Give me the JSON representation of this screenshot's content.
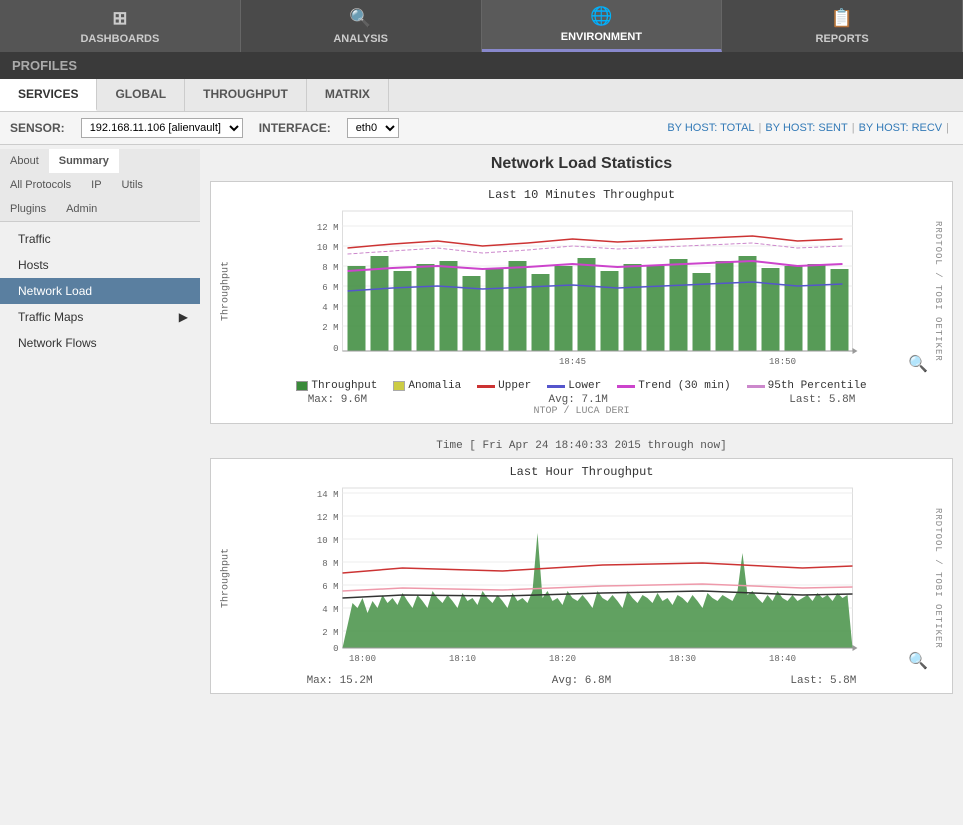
{
  "nav": {
    "items": [
      {
        "id": "dashboards",
        "label": "DASHBOARDS",
        "icon": "⊞",
        "active": false
      },
      {
        "id": "analysis",
        "label": "ANALYSIS",
        "icon": "🔍",
        "active": false
      },
      {
        "id": "environment",
        "label": "ENVIRONMENT",
        "icon": "🌐",
        "active": true
      },
      {
        "id": "reports",
        "label": "REPORTS",
        "icon": "📋",
        "active": false
      }
    ]
  },
  "profiles_label": "PROFILES",
  "sub_tabs": [
    {
      "label": "SERVICES",
      "active": true
    },
    {
      "label": "GLOBAL",
      "active": false
    },
    {
      "label": "THROUGHPUT",
      "active": false
    },
    {
      "label": "MATRIX",
      "active": false
    }
  ],
  "sensor": {
    "label": "SENSOR:",
    "value": "192.168.11.106 [alienvault]",
    "interface_label": "INTERFACE:",
    "interface_value": "eth0"
  },
  "by_host": {
    "total": "BY HOST: TOTAL",
    "sent": "BY HOST: SENT",
    "recv": "BY HOST: RECV"
  },
  "left_menu": {
    "tabs": [
      {
        "label": "About"
      },
      {
        "label": "Summary",
        "active": true
      },
      {
        "label": "All Protocols"
      },
      {
        "label": "IP"
      },
      {
        "label": "Utils"
      },
      {
        "label": "Plugins"
      },
      {
        "label": "Admin"
      }
    ],
    "items": [
      {
        "label": "Traffic",
        "active": false
      },
      {
        "label": "Hosts",
        "active": false
      },
      {
        "label": "Network Load",
        "active": true
      },
      {
        "label": "Traffic Maps",
        "has_arrow": true,
        "active": false
      },
      {
        "label": "Network Flows",
        "active": false
      }
    ]
  },
  "main": {
    "section_title": "Network Load Statistics",
    "chart1": {
      "title": "Last 10 Minutes Throughput",
      "y_label": "Throughput",
      "right_label": "RRDTOOL / TOBI OETIKER",
      "x_ticks": [
        "18:45",
        "18:50"
      ],
      "y_ticks": [
        "2 M",
        "4 M",
        "6 M",
        "8 M",
        "10 M",
        "12 M"
      ],
      "stats": "Max: 9.6M     Avg: 7.1M     Last: 5.8M",
      "legend": [
        {
          "color": "#4a9a4a",
          "label": "Throughput",
          "type": "box"
        },
        {
          "color": "#cccc44",
          "label": "Anomalia",
          "type": "box"
        },
        {
          "color": "#cc4444",
          "label": "Upper",
          "type": "line"
        },
        {
          "color": "#4444cc",
          "label": "Lower",
          "type": "line"
        },
        {
          "color": "#aa44aa",
          "label": "Trend (30 min)",
          "type": "line"
        },
        {
          "color": "#cc44cc",
          "label": "95th Percentile",
          "type": "line"
        }
      ],
      "credit": "NTOP / LUCA DERI"
    },
    "time_label": "Time [ Fri Apr 24 18:40:33 2015 through now]",
    "chart2": {
      "title": "Last Hour Throughput",
      "y_label": "Throughput",
      "right_label": "RRDTOOL / TOBI OETIKER",
      "x_ticks": [
        "18:00",
        "18:10",
        "18:20",
        "18:30",
        "18:40"
      ],
      "y_ticks": [
        "2 M",
        "4 M",
        "6 M",
        "8 M",
        "10 M",
        "12 M",
        "14 M"
      ],
      "stats": "Max: 15.2M     Avg: 6.8M     Last: 5.8M"
    }
  }
}
